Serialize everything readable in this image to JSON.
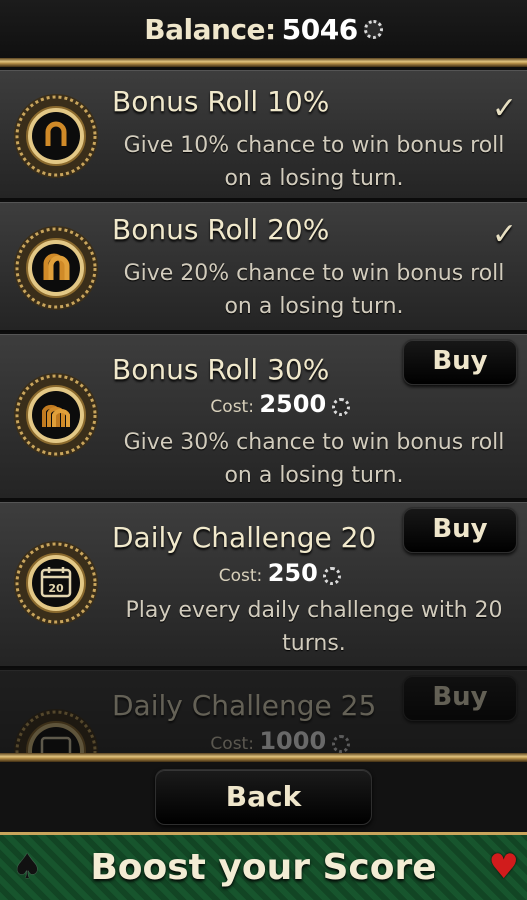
{
  "header": {
    "balance_label": "Balance:",
    "balance_value": "5046",
    "currency_icon": "coin-icon"
  },
  "items": [
    {
      "title": "Bonus Roll 10%",
      "description": "Give 10% chance to win bonus roll on a losing turn.",
      "status": "owned",
      "check_glyph": "✓",
      "icon": "horseshoe-1-icon"
    },
    {
      "title": "Bonus Roll 20%",
      "description": "Give 20% chance to win bonus roll on a losing turn.",
      "status": "owned",
      "check_glyph": "✓",
      "icon": "horseshoe-2-icon"
    },
    {
      "title": "Bonus Roll 30%",
      "cost_label": "Cost:",
      "cost_value": "2500",
      "buy_label": "Buy",
      "description": "Give 30% chance to win bonus roll on a losing turn.",
      "icon": "horseshoe-3-icon"
    },
    {
      "title": "Daily Challenge 20",
      "cost_label": "Cost:",
      "cost_value": "250",
      "buy_label": "Buy",
      "description": "Play every daily challenge with 20 turns.",
      "icon": "calendar-icon",
      "calendar_day": "20"
    },
    {
      "title": "Daily Challenge 25",
      "cost_label": "Cost:",
      "cost_value": "1000",
      "buy_label": "Buy",
      "icon": "calendar-icon"
    }
  ],
  "back_label": "Back",
  "banner": {
    "text": "Boost your Score",
    "left_icon": "spade-icon",
    "right_icon": "heart-icon"
  },
  "colors": {
    "gold": "#c9a55c",
    "banner_green": "#17552d",
    "text_cream": "#efe6cb"
  }
}
